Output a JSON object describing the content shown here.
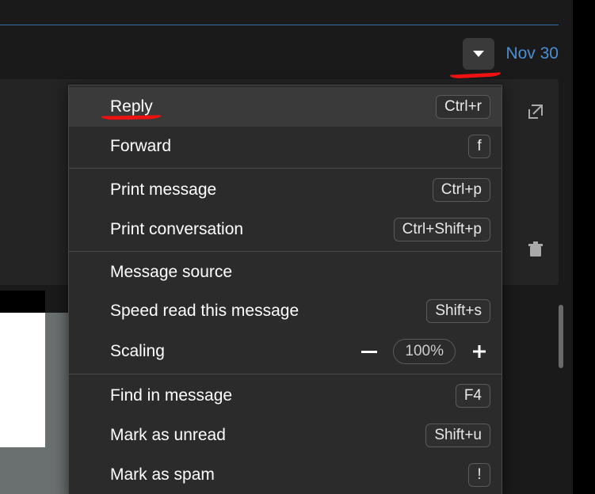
{
  "header": {
    "date": "Nov 30"
  },
  "icons": {
    "open_external": "open-external-icon",
    "trash": "trash-icon"
  },
  "menu": {
    "groups": [
      [
        {
          "label": "Reply",
          "shortcut": "Ctrl+r",
          "hover": true
        },
        {
          "label": "Forward",
          "shortcut": "f"
        }
      ],
      [
        {
          "label": "Print message",
          "shortcut": "Ctrl+p"
        },
        {
          "label": "Print conversation",
          "shortcut": "Ctrl+Shift+p"
        }
      ],
      [
        {
          "label": "Message source"
        },
        {
          "label": "Speed read this message",
          "shortcut": "Shift+s"
        },
        {
          "label": "Scaling",
          "type": "scaling",
          "zoom": "100%"
        }
      ],
      [
        {
          "label": "Find in message",
          "shortcut": "F4"
        },
        {
          "label": "Mark as unread",
          "shortcut": "Shift+u"
        },
        {
          "label": "Mark as spam",
          "shortcut": "!"
        }
      ]
    ]
  }
}
